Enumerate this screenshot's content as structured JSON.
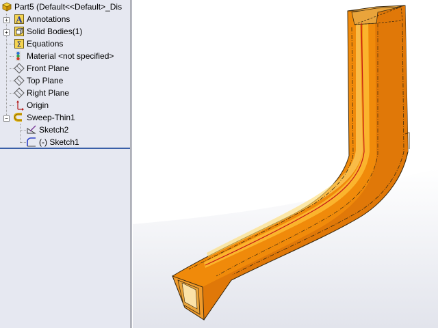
{
  "tree": {
    "root": "Part5  (Default<<Default>_Dis",
    "items": [
      {
        "label": "Annotations",
        "icon": "annotations-icon"
      },
      {
        "label": "Solid Bodies(1)",
        "icon": "solid-bodies-icon"
      },
      {
        "label": "Equations",
        "icon": "equations-icon"
      },
      {
        "label": "Material <not specified>",
        "icon": "material-icon"
      },
      {
        "label": "Front Plane",
        "icon": "plane-icon"
      },
      {
        "label": "Top Plane",
        "icon": "plane-icon"
      },
      {
        "label": "Right Plane",
        "icon": "plane-icon"
      },
      {
        "label": "Origin",
        "icon": "origin-icon"
      },
      {
        "label": "Sweep-Thin1",
        "icon": "sweep-thin-icon"
      }
    ],
    "sweep_children": [
      {
        "label": "Sketch2",
        "icon": "sketch-icon"
      },
      {
        "label": "(-) Sketch1",
        "icon": "sketch-icon"
      }
    ]
  },
  "colors": {
    "panel_bg": "#e6e8f1",
    "part_orange": "#f08a0a",
    "edge_dark": "#3b2a10",
    "path_red": "#c41616"
  }
}
